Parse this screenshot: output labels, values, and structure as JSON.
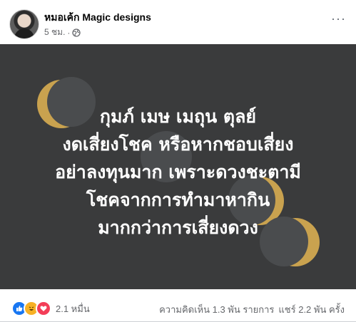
{
  "post": {
    "author": "หมอเค้ก Magic designs",
    "time": "5 ชม.",
    "more_label": "···"
  },
  "image": {
    "lines": [
      "กุมภ์ เมษ เมถุน ตุลย์",
      "งดเสี่ยงโชค หรือหากชอบเสี่ยง",
      "อย่าลงทุนมาก เพราะดวงชะตามี",
      "โชคจากการทำมาหากิน",
      "มากกว่าการเสี่ยงดวง"
    ],
    "colors": {
      "background": "#3a3b3c",
      "text": "#ffffff",
      "moon_gold": "#c9a24f"
    }
  },
  "footer": {
    "reactions": [
      "like-icon",
      "haha-icon",
      "love-icon"
    ],
    "reaction_count": "2.1 หมื่น",
    "comments": "ความคิดเห็น 1.3 พัน รายการ",
    "shares": "แชร์ 2.2 พัน ครั้ง"
  }
}
